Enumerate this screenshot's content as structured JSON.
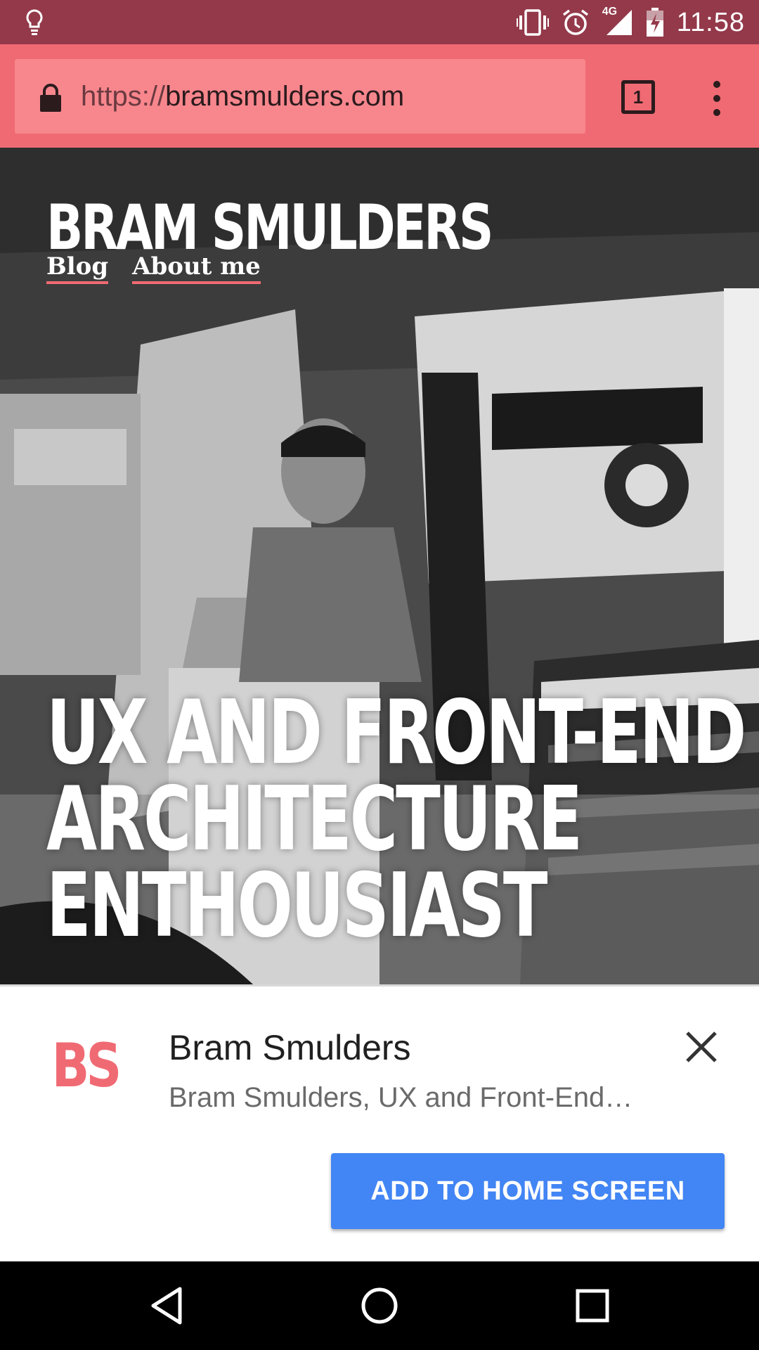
{
  "status_bar": {
    "time": "11:58",
    "network": "4G",
    "icons": [
      "lightbulb-icon",
      "vibrate-icon",
      "alarm-icon",
      "signal-icon",
      "battery-icon"
    ]
  },
  "browser": {
    "url_scheme": "https://",
    "url_host": "bramsmulders.com",
    "tab_count": "1",
    "toolbar_color": "#f06a73"
  },
  "hero": {
    "site_title": "BRAM SMULDERS",
    "nav": [
      {
        "label": "Blog"
      },
      {
        "label": "About me"
      }
    ],
    "headline_lines": [
      "UX AND FRONT-END",
      "ARCHITECTURE",
      "ENTHOUSIAST"
    ]
  },
  "banner": {
    "logo_text": "BS",
    "app_name": "Bram Smulders",
    "app_description": "Bram Smulders, UX and Front-End…",
    "add_button_label": "ADD TO HOME SCREEN",
    "button_color": "#4285f4"
  },
  "navbar": {
    "icons": [
      "back-icon",
      "home-icon",
      "recents-icon"
    ]
  }
}
